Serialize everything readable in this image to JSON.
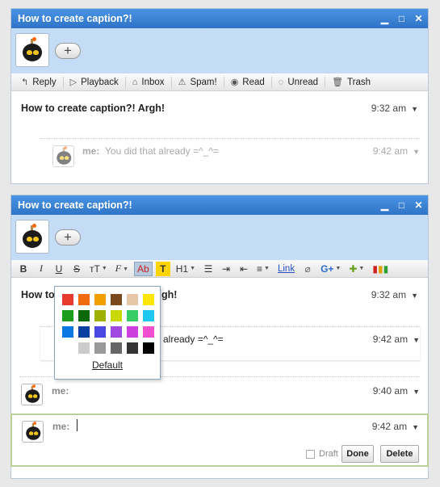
{
  "window": {
    "title": "How to create caption?!",
    "controls": [
      "▁",
      "□",
      "✕"
    ]
  },
  "toolbar": {
    "items": [
      {
        "icon": "reply-icon",
        "glyph": "↰",
        "label": "Reply"
      },
      {
        "icon": "play-icon",
        "glyph": "▷",
        "label": "Playback"
      },
      {
        "icon": "inbox-icon",
        "glyph": "⌂",
        "label": "Inbox"
      },
      {
        "icon": "spam-icon",
        "glyph": "⚠",
        "label": "Spam!"
      },
      {
        "icon": "eye-icon",
        "glyph": "◉",
        "label": "Read"
      },
      {
        "icon": "unread-icon",
        "glyph": "◌",
        "label": "Unread"
      },
      {
        "icon": "trash-icon",
        "glyph": "🗑",
        "label": "Trash"
      }
    ]
  },
  "message": {
    "subject": "How to create caption?! Argh!",
    "time": "9:32 am"
  },
  "reply1": {
    "author": "me:",
    "text": "You did that already =^_^=",
    "time": "9:42 am"
  },
  "editor_toolbar": {
    "bold": "B",
    "italic": "I",
    "underline": "U",
    "strike": "S",
    "size": "тT",
    "font": "F",
    "text_color": "Ab",
    "highlight": "T",
    "heading": "H1",
    "link": "Link"
  },
  "panel2": {
    "subject_visible": "How to",
    "subject_tail": "gh!",
    "reply_text_visible": "already =^_^=",
    "reply2": {
      "author": "me:",
      "time": "9:40 am"
    },
    "compose": {
      "author": "me:",
      "time": "9:42 am",
      "draft_label": "Draft",
      "done_label": "Done",
      "delete_label": "Delete"
    }
  },
  "palette": {
    "colors": [
      "#e63b2e",
      "#f06a0f",
      "#f0a000",
      "#7a4a1e",
      "#e6c8a8",
      "#ffe600",
      "#1e9c1e",
      "#0a6a0a",
      "#a0b000",
      "#c8d800",
      "#38cc66",
      "#1ec8f0",
      "#0a78e0",
      "#0a40a0",
      "#4a48e0",
      "#a048e0",
      "#cc40e0",
      "#f050d0",
      "#ffffff",
      "#cccccc",
      "#999999",
      "#666666",
      "#333333",
      "#000000"
    ],
    "default_label": "Default"
  }
}
